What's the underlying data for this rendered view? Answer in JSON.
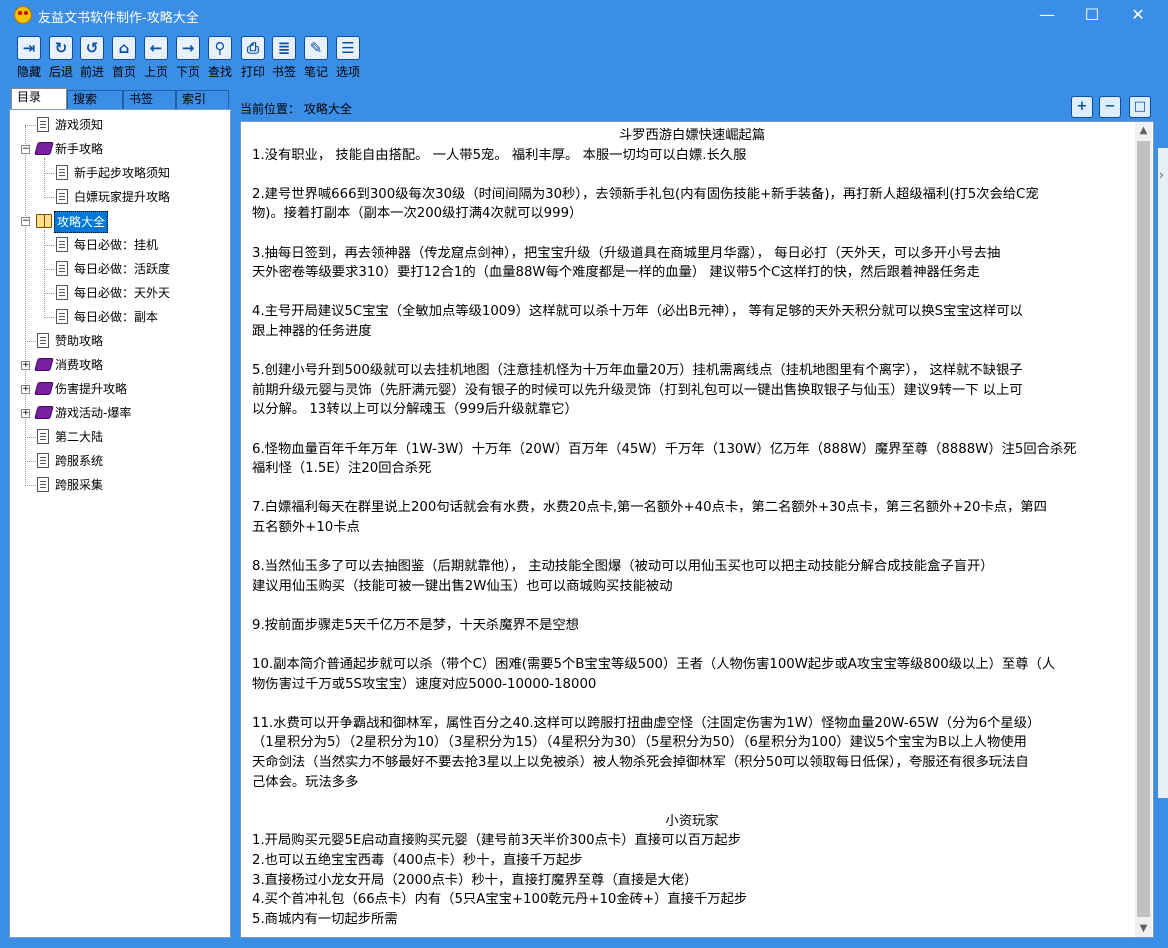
{
  "window": {
    "title": "友益文书软件制作-攻略大全",
    "min_glyph": "—",
    "max_glyph": "☐",
    "close_glyph": "✕"
  },
  "toolbar": {
    "items": [
      {
        "label": "隐藏",
        "icon": "hide-icon",
        "glyph": "⇥"
      },
      {
        "label": "后退",
        "icon": "back-refresh-icon",
        "glyph": "↻"
      },
      {
        "label": "前进",
        "icon": "forward-refresh-icon",
        "glyph": "↺"
      },
      {
        "label": "首页",
        "icon": "home-icon",
        "glyph": "⌂"
      },
      {
        "label": "上页",
        "icon": "arrow-left-icon",
        "glyph": "←"
      },
      {
        "label": "下页",
        "icon": "arrow-right-icon",
        "glyph": "→"
      },
      {
        "label": "查找",
        "icon": "search-icon",
        "glyph": "⚲"
      },
      {
        "label": "打印",
        "icon": "print-icon",
        "glyph": "⎙"
      },
      {
        "label": "书签",
        "icon": "bookmark-icon",
        "glyph": "≣"
      },
      {
        "label": "笔记",
        "icon": "note-icon",
        "glyph": "✎"
      },
      {
        "label": "选项",
        "icon": "options-icon",
        "glyph": "☰"
      }
    ]
  },
  "tabs": [
    {
      "label": "目录"
    },
    {
      "label": "搜索"
    },
    {
      "label": "书签"
    },
    {
      "label": "索引"
    }
  ],
  "tree": {
    "nodes": [
      {
        "label": "游戏须知",
        "type": "doc",
        "expander": ""
      },
      {
        "label": "新手攻略",
        "type": "book",
        "expander": "−"
      },
      {
        "label": "新手起步攻略须知",
        "type": "doc",
        "expander": ""
      },
      {
        "label": "白嫖玩家提升攻略",
        "type": "doc",
        "expander": ""
      },
      {
        "label": "攻略大全",
        "type": "book-open",
        "expander": "−"
      },
      {
        "label": "每日必做：挂机",
        "type": "doc",
        "expander": ""
      },
      {
        "label": "每日必做：活跃度",
        "type": "doc",
        "expander": ""
      },
      {
        "label": "每日必做：天外天",
        "type": "doc",
        "expander": ""
      },
      {
        "label": "每日必做：副本",
        "type": "doc",
        "expander": ""
      },
      {
        "label": "赞助攻略",
        "type": "doc",
        "expander": ""
      },
      {
        "label": "消费攻略",
        "type": "book",
        "expander": "+"
      },
      {
        "label": "伤害提升攻略",
        "type": "book",
        "expander": "+"
      },
      {
        "label": "游戏活动-爆率",
        "type": "book",
        "expander": "+"
      },
      {
        "label": "第二大陆",
        "type": "doc",
        "expander": ""
      },
      {
        "label": "跨服系统",
        "type": "doc",
        "expander": ""
      },
      {
        "label": "跨服采集",
        "type": "doc",
        "expander": ""
      }
    ]
  },
  "location": {
    "label": "当前位置：  攻略大全"
  },
  "zoom": {
    "zoom_in_glyph": "+",
    "zoom_out_glyph": "−",
    "fullscreen_glyph": "□"
  },
  "scrollbar": {
    "up_glyph": "▲",
    "down_glyph": "▼"
  },
  "right_edge_glyph": "›",
  "article": {
    "lines": [
      {
        "text": "斗罗西游白嫖快速崛起篇",
        "center": true
      },
      {
        "text": "1.没有职业，  技能自由搭配。  一人带5宠。  福利丰厚。  本服一切均可以白嫖.长久服"
      },
      {
        "text": ""
      },
      {
        "text": "2.建号世界喊666到300级每次30级（时间间隔为30秒），去领新手礼包(内有固伤技能+新手装备)，再打新人超级福利(打5次会给C宠"
      },
      {
        "text": "物)。接着打副本（副本一次200级打满4次就可以999）"
      },
      {
        "text": ""
      },
      {
        "text": "3.抽每日签到，再去领神器（传龙窟点剑神），把宝宝升级（升级道具在商城里月华露），    每日必打（天外天，可以多开小号去抽"
      },
      {
        "text": "天外密卷等级要求310）要打12合1的（血量88W每个难度都是一样的血量）    建议带5个C这样打的快，然后跟着神器任务走"
      },
      {
        "text": ""
      },
      {
        "text": "4.主号开局建议5C宝宝（全敏加点等级1009）这样就可以杀十万年（必出B元神），  等有足够的天外天积分就可以换S宝宝这样可以"
      },
      {
        "text": "跟上神器的任务进度"
      },
      {
        "text": ""
      },
      {
        "text": "5.创建小号升到500级就可以去挂机地图（注意挂机怪为十万年血量20万）挂机需离线点（挂机地图里有个离字），    这样就不缺银子"
      },
      {
        "text": "前期升级元婴与灵饰（先肝满元婴）没有银子的时候可以先升级灵饰（打到礼包可以一键出售换取银子与仙玉）建议9转一下  以上可"
      },
      {
        "text": "以分解。  13转以上可以分解魂玉（999后升级就靠它）"
      },
      {
        "text": ""
      },
      {
        "text": "6.怪物血量百年千年万年（1W-3W）十万年（20W）百万年（45W）千万年（130W）亿万年（888W）魔界至尊（8888W）注5回合杀死"
      },
      {
        "text": "福利怪（1.5E）注20回合杀死"
      },
      {
        "text": ""
      },
      {
        "text": "7.白嫖福利每天在群里说上200句话就会有水费，水费20点卡,第一名额外+40点卡，第二名额外+30点卡，第三名额外+20卡点，第四"
      },
      {
        "text": "五名额外+10卡点"
      },
      {
        "text": ""
      },
      {
        "text": "8.当然仙玉多了可以去抽图鉴（后期就靠他），    主动技能全图爆（被动可以用仙玉买也可以把主动技能分解合成技能盒子盲开）"
      },
      {
        "text": "建议用仙玉购买（技能可被一键出售2W仙玉）也可以商城购买技能被动"
      },
      {
        "text": ""
      },
      {
        "text": "9.按前面步骤走5天千亿万不是梦，十天杀魔界不是空想"
      },
      {
        "text": ""
      },
      {
        "text": "10.副本简介普通起步就可以杀（带个C）困难(需要5个B宝宝等级500）王者（人物伤害100W起步或A攻宝宝等级800级以上）至尊（人"
      },
      {
        "text": "物伤害过千万或5S攻宝宝）速度对应5000-10000-18000"
      },
      {
        "text": ""
      },
      {
        "text": "11.水费可以开争霸战和御林军，属性百分之40.这样可以跨服打扭曲虚空怪（注固定伤害为1W）怪物血量20W-65W（分为6个星级）"
      },
      {
        "text": "（1星积分为5）（2星积分为10）（3星积分为15）（4星积分为30）（5星积分为50）（6星积分为100）建议5个宝宝为B以上人物使用"
      },
      {
        "text": "天命剑法（当然实力不够最好不要去抢3星以上以免被杀）被人物杀死会掉御林军（积分50可以领取每日低保），夸服还有很多玩法自"
      },
      {
        "text": "己体会。玩法多多"
      },
      {
        "text": ""
      },
      {
        "text": "小资玩家",
        "center": true
      },
      {
        "text": "1.开局购买元婴5E启动直接购买元婴（建号前3天半价300点卡）直接可以百万起步"
      },
      {
        "text": "2.也可以五绝宝宝西毒（400点卡）秒十，直接千万起步"
      },
      {
        "text": "3.直接杨过小龙女开局（2000点卡）秒十，直接打魔界至尊（直接是大佬）"
      },
      {
        "text": "4.买个首冲礼包（66点卡）内有（5只A宝宝+100乾元丹+10金砖+）直接千万起步"
      },
      {
        "text": "5.商城内有一切起步所需"
      }
    ]
  }
}
